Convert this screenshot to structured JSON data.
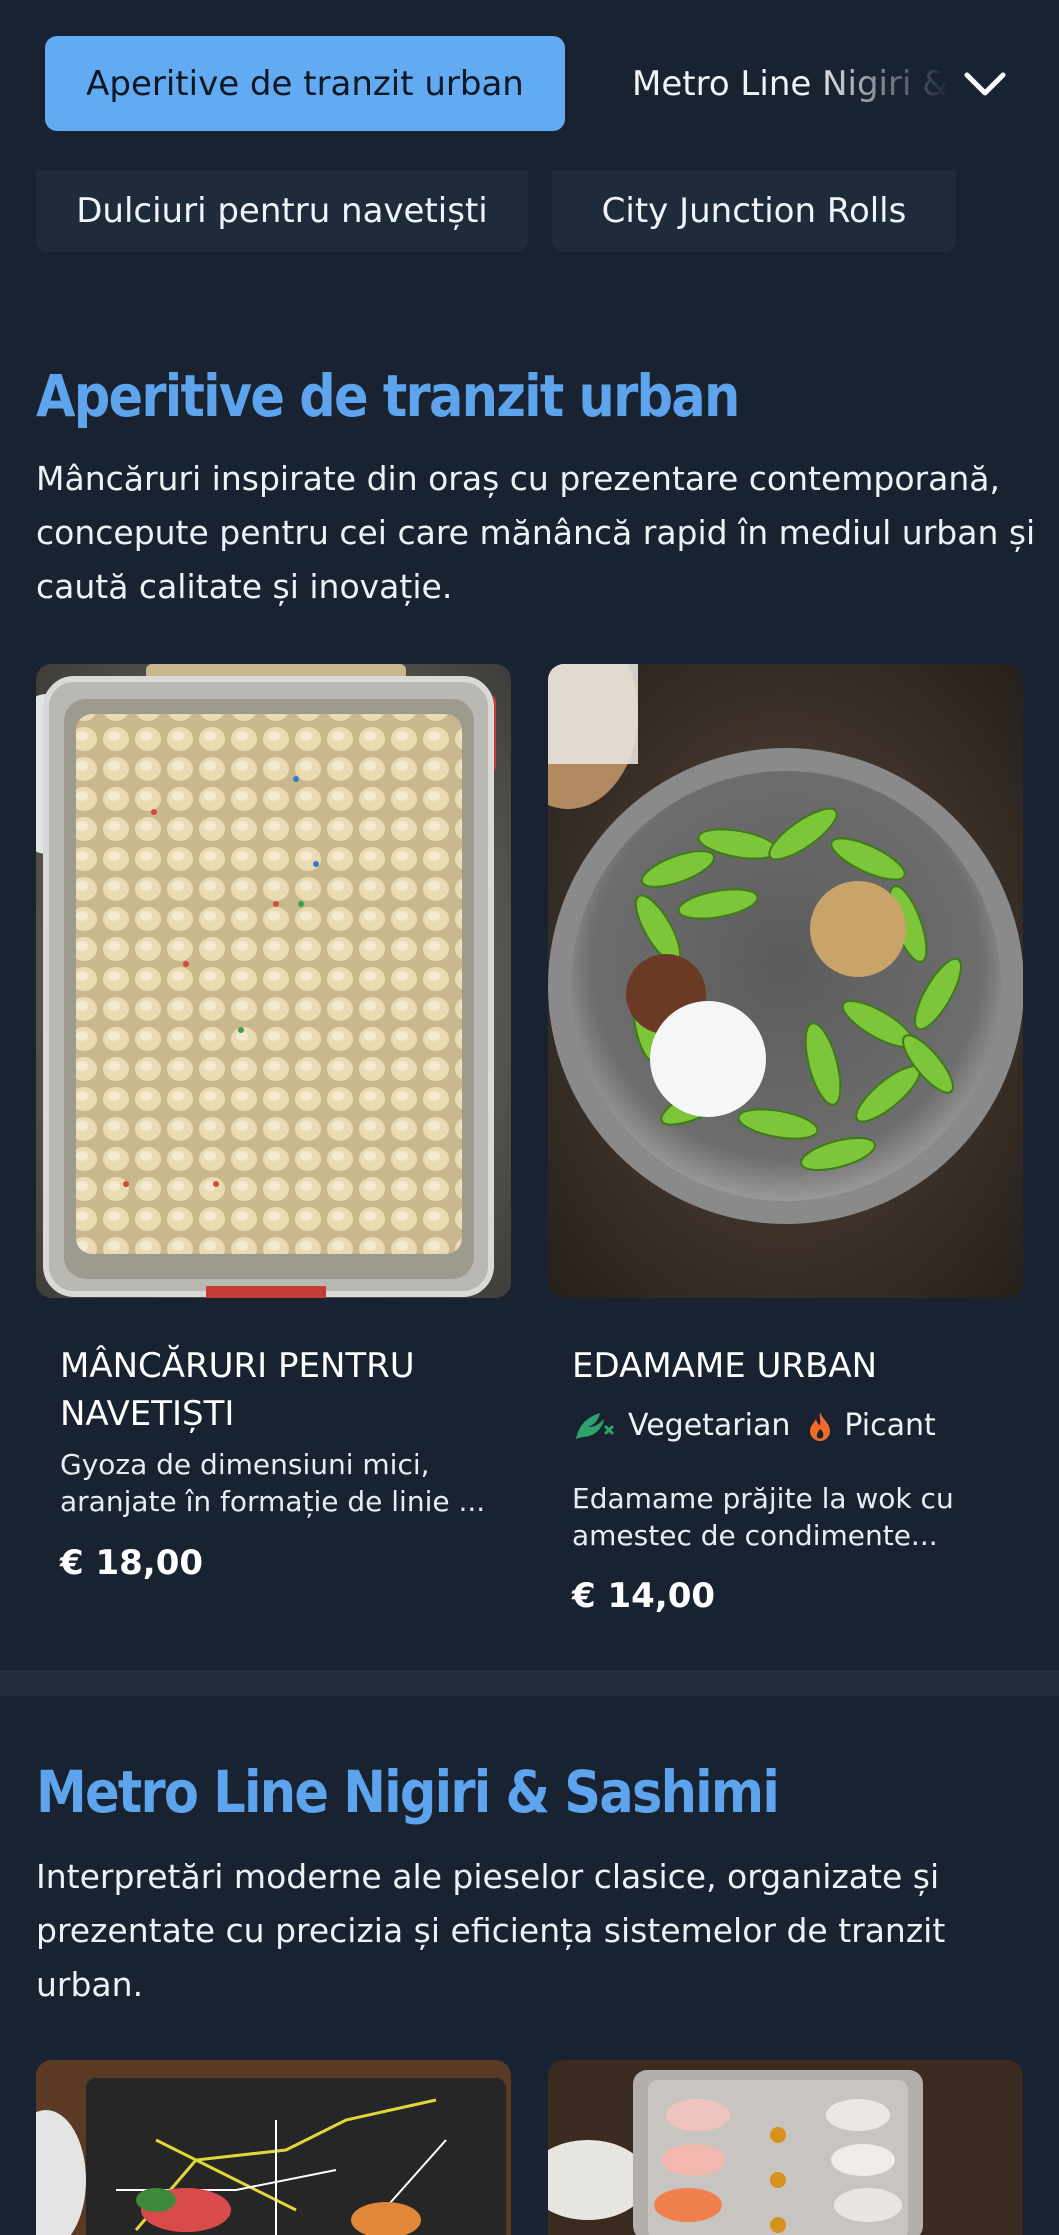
{
  "tabs": {
    "active_label": "Aperitive de tranzit urban",
    "next_label": "Metro Line Nigiri & Sashimi",
    "chips": [
      "Dulciuri pentru navetiști",
      "City Junction Rolls"
    ]
  },
  "sections": [
    {
      "title": "Aperitive de tranzit urban",
      "description": "Mâncăruri inspirate din oraș cu prezentare contemporană, concepute pentru cei care mănâncă rapid în mediul urban și caută calitate și inovație.",
      "items": [
        {
          "name": "MÂNCĂRURI PENTRU NAVETIȘTI",
          "description": "Gyoza de dimensiuni mici, aranjate în formație de linie ...",
          "price": "€ 18,00"
        },
        {
          "name": "EDAMAME URBAN",
          "tags": [
            "Vegetarian",
            "Picant"
          ],
          "description": "Edamame prăjite la wok cu amestec de condimente...",
          "price": "€ 14,00"
        }
      ]
    },
    {
      "title": "Metro Line Nigiri & Sashimi",
      "description": "Interpretări moderne ale pieselor clasice, organizate și prezentate cu precizia și eficiența sistemelor de tranzit urban."
    }
  ],
  "colors": {
    "accent": "#62aaf2",
    "background": "#182231",
    "heading": "#5ea4ec",
    "vegetarian": "#2ea36b",
    "spicy": "#f26a2a"
  },
  "icons": [
    "chevron-down-icon",
    "vegetarian-icon",
    "spicy-icon"
  ]
}
